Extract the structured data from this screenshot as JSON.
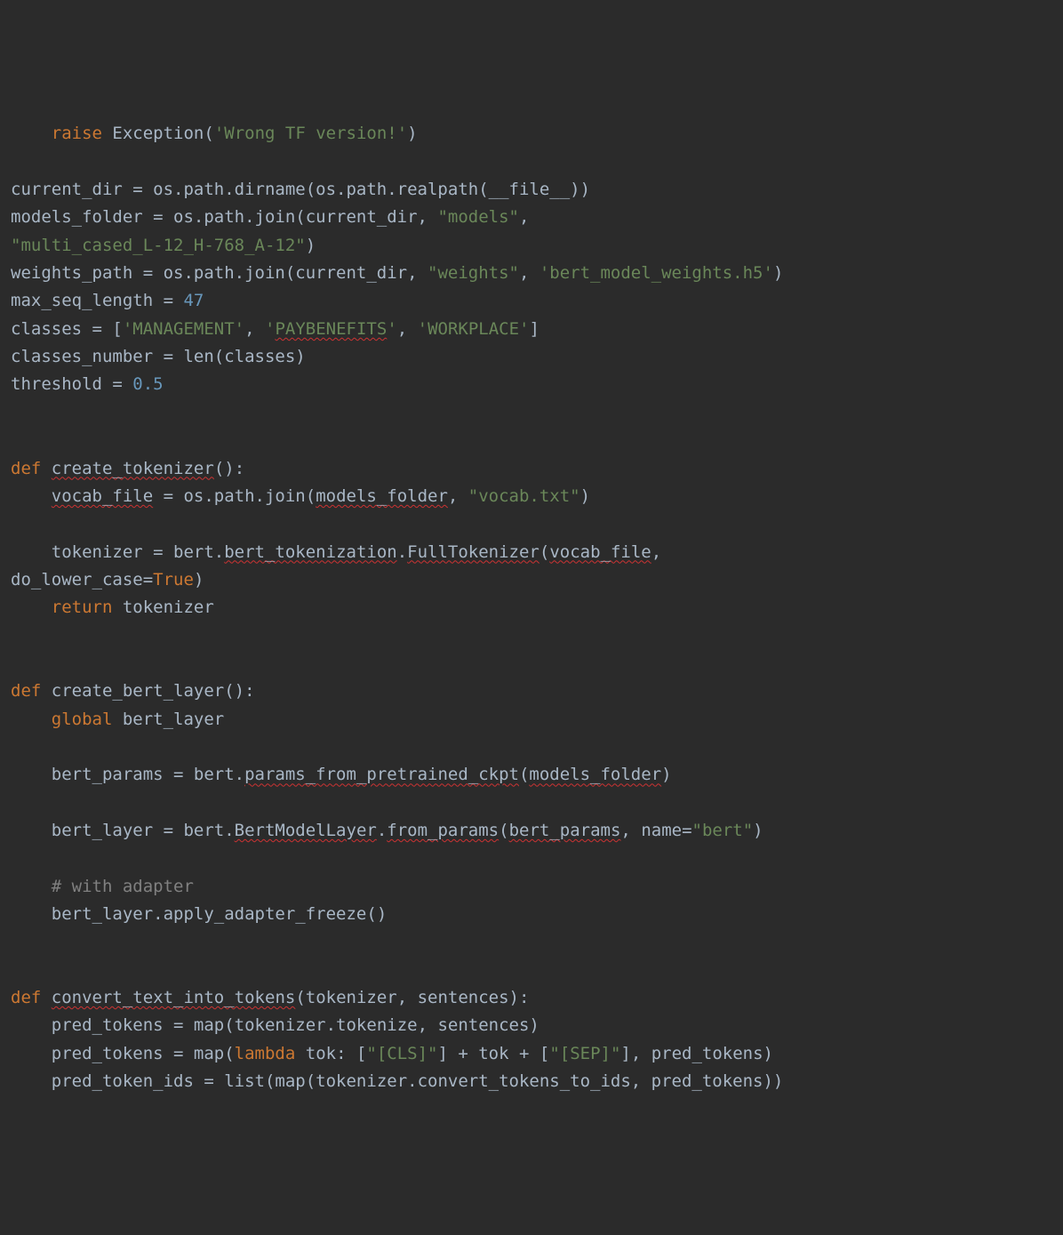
{
  "lines": {
    "l1_raise": "raise",
    "l1_exc": "Exception(",
    "l1_str": "'Wrong TF version!'",
    "l1_close": ")",
    "l3": "current_dir = os.path.dirname(os.path.realpath(__file__))",
    "l4a": "models_folder = os.path.join(current_dir, ",
    "l4s": "\"models\"",
    "l4b": ",",
    "l5s": "\"multi_cased_L-12_H-768_A-12\"",
    "l5b": ")",
    "l6a": "weights_path = os.path.join(current_dir, ",
    "l6s1": "\"weights\"",
    "l6m": ", ",
    "l6s2": "'bert_model_weights.h5'",
    "l6b": ")",
    "l7a": "max_seq_length = ",
    "l7n": "47",
    "l8a": "classes = [",
    "l8s1": "'MANAGEMENT'",
    "l8m1": ", ",
    "l8s2": "'",
    "l8s2b": "PAYBENEFITS",
    "l8s2c": "'",
    "l8m2": ", ",
    "l8s3": "'WORKPLACE'",
    "l8b": "]",
    "l9": "classes_number = len(classes)",
    "l10a": "threshold = ",
    "l10n": "0.5",
    "l12_def": "def",
    "l12_name": "create_tokenizer",
    "l12_rest": "():",
    "l13a": "vocab_file",
    "l13b": " = os.path.join(",
    "l13c": "models_folder",
    "l13d": ", ",
    "l13s": "\"vocab.txt\"",
    "l13e": ")",
    "l15a": "tokenizer = bert.",
    "l15b": "bert_tokenization",
    "l15c": ".",
    "l15d": "FullTokenizer",
    "l15e": "(",
    "l15f": "vocab_file",
    "l15g": ",",
    "l16a": "do_lower_case",
    "l16b": "=",
    "l16c": "True",
    "l16d": ")",
    "l17_ret": "return",
    "l17_rest": " tokenizer",
    "l20_def": "def",
    "l20_rest": " create_bert_layer():",
    "l21_glob": "global",
    "l21_rest": " bert_layer",
    "l23a": "bert_params = bert.",
    "l23b": "params_from_pretrained_ckpt",
    "l23c": "(",
    "l23d": "models_folder",
    "l23e": ")",
    "l25a": "bert_layer = bert.",
    "l25b": "BertModelLayer",
    "l25c": ".",
    "l25d": "from_params",
    "l25e": "(",
    "l25f": "bert_params",
    "l25g": ", ",
    "l25h": "name",
    "l25i": "=",
    "l25s": "\"bert\"",
    "l25j": ")",
    "l27": "# with adapter",
    "l28": "bert_layer.apply_adapter_freeze()",
    "l31_def": "def",
    "l31_sp": " ",
    "l31_name": "convert_text_into_tokens",
    "l31_rest": "(tokenizer, sentences):",
    "l32": "pred_tokens = map(tokenizer.tokenize, sentences)",
    "l33a": "pred_tokens = map(",
    "l33_lam": "lambda",
    "l33b": " tok: [",
    "l33s1": "\"[CLS]\"",
    "l33c": "] + tok + [",
    "l33s2": "\"[SEP]\"",
    "l33d": "], pred_tokens)",
    "l34": "pred_token_ids = list(map(tokenizer.convert_tokens_to_ids, pred_tokens))"
  }
}
